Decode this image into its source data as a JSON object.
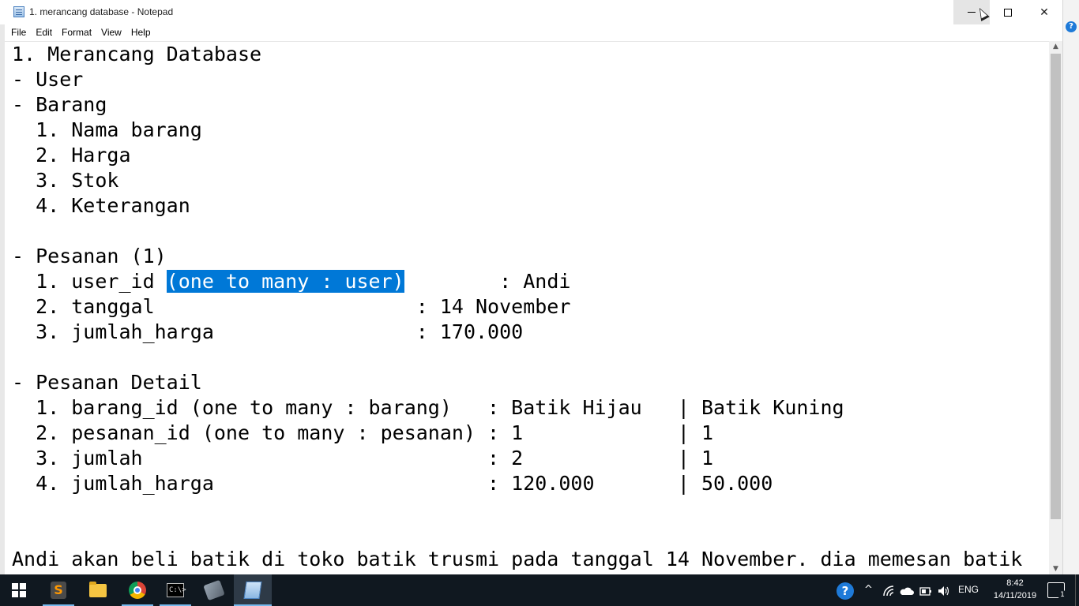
{
  "window": {
    "title": "1. merancang database - Notepad",
    "minimize_glyph": "",
    "maximize_glyph": "",
    "close_glyph": "✕"
  },
  "menu": {
    "items": [
      "File",
      "Edit",
      "Format",
      "View",
      "Help"
    ]
  },
  "document": {
    "lines_before_selection": "1. Merancang Database\n- User\n- Barang\n  1. Nama barang\n  2. Harga\n  3. Stok\n  4. Keterangan\n\n- Pesanan (1)\n  1. user_id ",
    "selected_text": "(one to many : user)",
    "lines_after_selection": "        : Andi\n  2. tanggal                      : 14 November\n  3. jumlah_harga                 : 170.000\n\n- Pesanan Detail\n  1. barang_id (one to many : barang)   : Batik Hijau   | Batik Kuning\n  2. pesanan_id (one to many : pesanan) : 1             | 1\n  3. jumlah                             : 2             | 1\n  4. jumlah_harga                       : 120.000       | 50.000\n\n\nAndi akan beli batik di toko batik trusmi pada tanggal 14 November. dia memesan batik"
  },
  "scrollbar": {
    "up_arrow": "▲",
    "down_arrow": "▼"
  },
  "taskbar": {
    "apps": [
      {
        "name": "start-button"
      },
      {
        "name": "sublime-text",
        "glyph": "S"
      },
      {
        "name": "file-explorer"
      },
      {
        "name": "google-chrome"
      },
      {
        "name": "command-prompt",
        "glyph": "C:\\>"
      },
      {
        "name": "utility-tool"
      },
      {
        "name": "notepad"
      }
    ],
    "tray": {
      "help_glyph": "?",
      "chevron_glyph": "^",
      "language": "ENG",
      "time": "8:42",
      "date": "14/11/2019",
      "notification_count": "1"
    }
  },
  "colors": {
    "selection": "#0078d7",
    "taskbar": "#101820",
    "accent": "#76b9ed"
  }
}
